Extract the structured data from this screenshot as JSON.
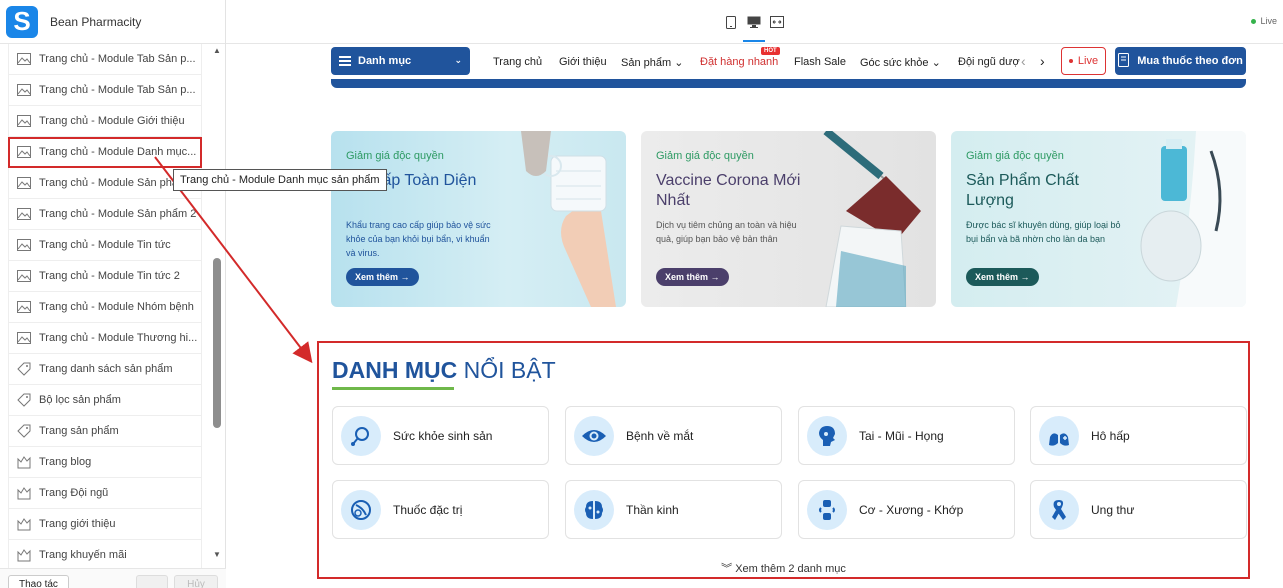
{
  "app": {
    "name": "Bean Pharmacity",
    "status": "Live"
  },
  "sidebar": {
    "items": [
      {
        "label": "Trang chủ - Module Tab Sản p...",
        "icon": "image-icon"
      },
      {
        "label": "Trang chủ - Module Tab Sản p...",
        "icon": "image-icon"
      },
      {
        "label": "Trang chủ - Module Giới thiệu",
        "icon": "image-icon"
      },
      {
        "label": "Trang chủ - Module Danh mục...",
        "icon": "image-icon",
        "active": true
      },
      {
        "label": "Trang chủ - Module Sản phẩm",
        "icon": "image-icon"
      },
      {
        "label": "Trang chủ - Module Sản phẩm 2",
        "icon": "image-icon"
      },
      {
        "label": "Trang chủ - Module Tin tức",
        "icon": "image-icon"
      },
      {
        "label": "Trang chủ - Module Tin tức 2",
        "icon": "image-icon"
      },
      {
        "label": "Trang chủ - Module Nhóm bệnh",
        "icon": "image-icon"
      },
      {
        "label": "Trang chủ - Module Thương hi...",
        "icon": "image-icon"
      },
      {
        "label": "Trang danh sách sản phẩm",
        "icon": "tag-icon"
      },
      {
        "label": "Bộ lọc sản phẩm",
        "icon": "tag-icon"
      },
      {
        "label": "Trang sản phẩm",
        "icon": "tag-icon"
      },
      {
        "label": "Trang blog",
        "icon": "gallery-icon"
      },
      {
        "label": "Trang Đội ngũ",
        "icon": "gallery-icon"
      },
      {
        "label": "Trang giới thiệu",
        "icon": "gallery-icon"
      },
      {
        "label": "Trang khuyến mãi",
        "icon": "gallery-icon"
      }
    ],
    "tooltip": "Trang chủ - Module Danh mục sản phẩm",
    "footer": {
      "actions_label": "Thao tác",
      "cancel_label": "Hủy"
    }
  },
  "nav": {
    "category_label": "Danh mục",
    "links": [
      {
        "label": "Trang chủ"
      },
      {
        "label": "Giới thiệu"
      },
      {
        "label": "Sản phẩm"
      },
      {
        "label": "Đặt hàng nhanh"
      },
      {
        "label": "Flash Sale"
      },
      {
        "label": "Góc sức khỏe"
      },
      {
        "label": "Đội ngũ dược"
      }
    ],
    "hot_badge": "HOT",
    "live_label": "Live",
    "rx_label": "Mua thuốc theo đơn"
  },
  "banners": [
    {
      "tag": "Giảm giá độc quyền",
      "title": "Hô Hấp Toàn Diện",
      "desc": "Khẩu trang cao cấp giúp bảo vệ sức khỏe của bạn khỏi bụi bẩn, vi khuẩn và virus.",
      "button": "Xem thêm →"
    },
    {
      "tag": "Giảm giá độc quyền",
      "title": "Vaccine Corona Mới Nhất",
      "desc": "Dịch vụ tiêm chủng an toàn và hiệu quả, giúp bạn bảo vệ bản thân",
      "button": "Xem thêm →"
    },
    {
      "tag": "Giảm giá độc quyền",
      "title": "Sản Phẩm Chất Lượng",
      "desc": "Được bác sĩ khuyên dùng, giúp loại bỏ bụi bẩn và bã nhờn cho làn da bạn",
      "button": "Xem thêm →"
    }
  ],
  "featured": {
    "title_bold": "DANH MỤC",
    "title_rest": "NỔI BẬT",
    "categories": [
      {
        "label": "Sức khỏe sinh sản",
        "icon": "reproductive-icon"
      },
      {
        "label": "Bệnh về mắt",
        "icon": "eye-icon"
      },
      {
        "label": "Tai - Mũi - Họng",
        "icon": "ent-icon"
      },
      {
        "label": "Hô hấp",
        "icon": "lungs-icon"
      },
      {
        "label": "Thuốc đặc trị",
        "icon": "pill-icon"
      },
      {
        "label": "Thần kinh",
        "icon": "brain-icon"
      },
      {
        "label": "Cơ - Xương - Khớp",
        "icon": "bone-icon"
      },
      {
        "label": "Ung thư",
        "icon": "ribbon-icon"
      }
    ],
    "more_label": "Xem thêm 2 danh mục"
  },
  "colors": {
    "brand": "#20549c",
    "accent_green": "#6fb84a",
    "highlight_red": "#d32a2a",
    "icon_bg": "#d8ecfb"
  }
}
